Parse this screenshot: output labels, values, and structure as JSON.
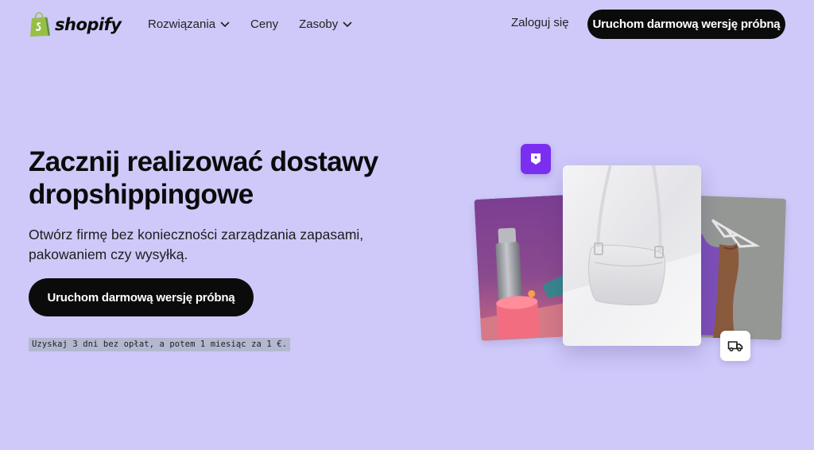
{
  "header": {
    "logo_text": "shopify",
    "nav": [
      {
        "label": "Rozwiązania",
        "has_dropdown": true
      },
      {
        "label": "Ceny",
        "has_dropdown": false
      },
      {
        "label": "Zasoby",
        "has_dropdown": true
      }
    ],
    "login_label": "Zaloguj się",
    "cta_label": "Uruchom darmową wersję próbną"
  },
  "hero": {
    "title_line1": "Zacznij realizować dostawy",
    "title_line2": "dropshippingowe",
    "subtitle_line1": "Otwórz firmę bez konieczności zarządzania zapasami,",
    "subtitle_line2": "pakowaniem czy wysyłką.",
    "cta_label": "Uruchom darmową wersję próbną",
    "trial_note": "Uzyskaj 3 dni bez opłat, a potem 1 miesiąc za 1 €."
  },
  "visuals": {
    "icons": [
      "shopify-bag-icon",
      "chevron-down-icon",
      "price-tag-icon",
      "delivery-truck-icon"
    ],
    "colors": {
      "page_background": "#cec9f9",
      "button_background": "#0b0b0b",
      "button_text": "#ffffff",
      "tag_badge": "#7a2ff0",
      "logo_green": "#95bf47"
    }
  }
}
